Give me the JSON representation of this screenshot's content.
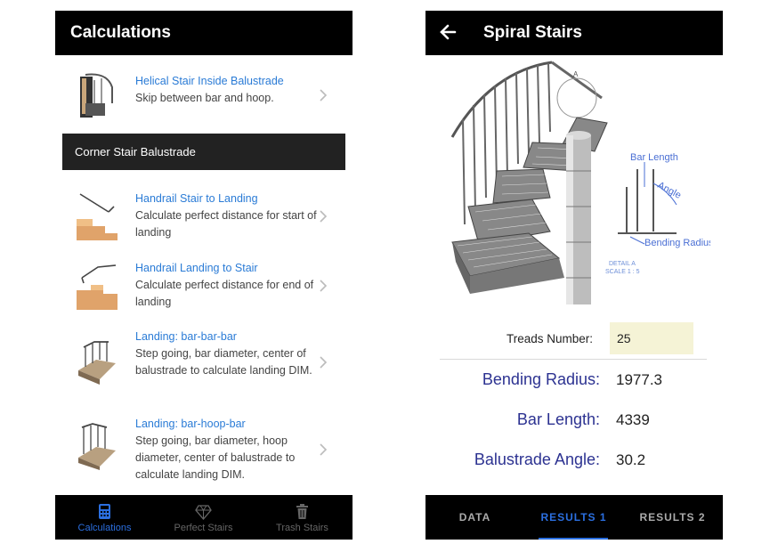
{
  "left": {
    "header": {
      "title": "Calculations"
    },
    "rows": [
      {
        "title": "Helical Stair Inside Balustrade",
        "desc": "Skip between bar and hoop."
      },
      {
        "title": "Handrail Stair to Landing",
        "desc": "Calculate perfect distance for start of landing"
      },
      {
        "title": "Handrail Landing to Stair",
        "desc": "Calculate perfect distance for end of landing"
      },
      {
        "title": "Landing: bar-bar-bar",
        "desc": "Step going, bar diameter, center of balustrade to calculate landing DIM."
      },
      {
        "title": "Landing: bar-hoop-bar",
        "desc": "Step going, bar diameter, hoop diameter, center of balustrade to calculate landing DIM."
      }
    ],
    "section_header": "Corner Stair Balustrade",
    "tabs": [
      {
        "label": "Calculations",
        "icon": "calculator-icon"
      },
      {
        "label": "Perfect Stairs",
        "icon": "diamond-icon"
      },
      {
        "label": "Trash Stairs",
        "icon": "trash-icon"
      }
    ]
  },
  "right": {
    "header": {
      "title": "Spiral Stairs",
      "back_icon": "back-arrow-icon"
    },
    "diagram": {
      "callout_a": "A",
      "bar_length": "Bar Length",
      "angle": "Angle",
      "bending_radius": "Bending Radius",
      "detail_line1": "DETAIL A",
      "detail_line2": "SCALE 1 : 5"
    },
    "treads": {
      "label": "Treads Number:",
      "value": "25"
    },
    "results": [
      {
        "label": "Bending Radius:",
        "value": "1977.3"
      },
      {
        "label": "Bar Length:",
        "value": "4339"
      },
      {
        "label": "Balustrade Angle:",
        "value": "30.2"
      }
    ],
    "segments": [
      "DATA",
      "RESULTS 1",
      "RESULTS 2"
    ]
  },
  "colors": {
    "accent": "#2b6fe0",
    "link": "#2a7bd6",
    "result_label": "#2c3291",
    "input_bg": "#f5f3d6",
    "bar": "#000000"
  }
}
